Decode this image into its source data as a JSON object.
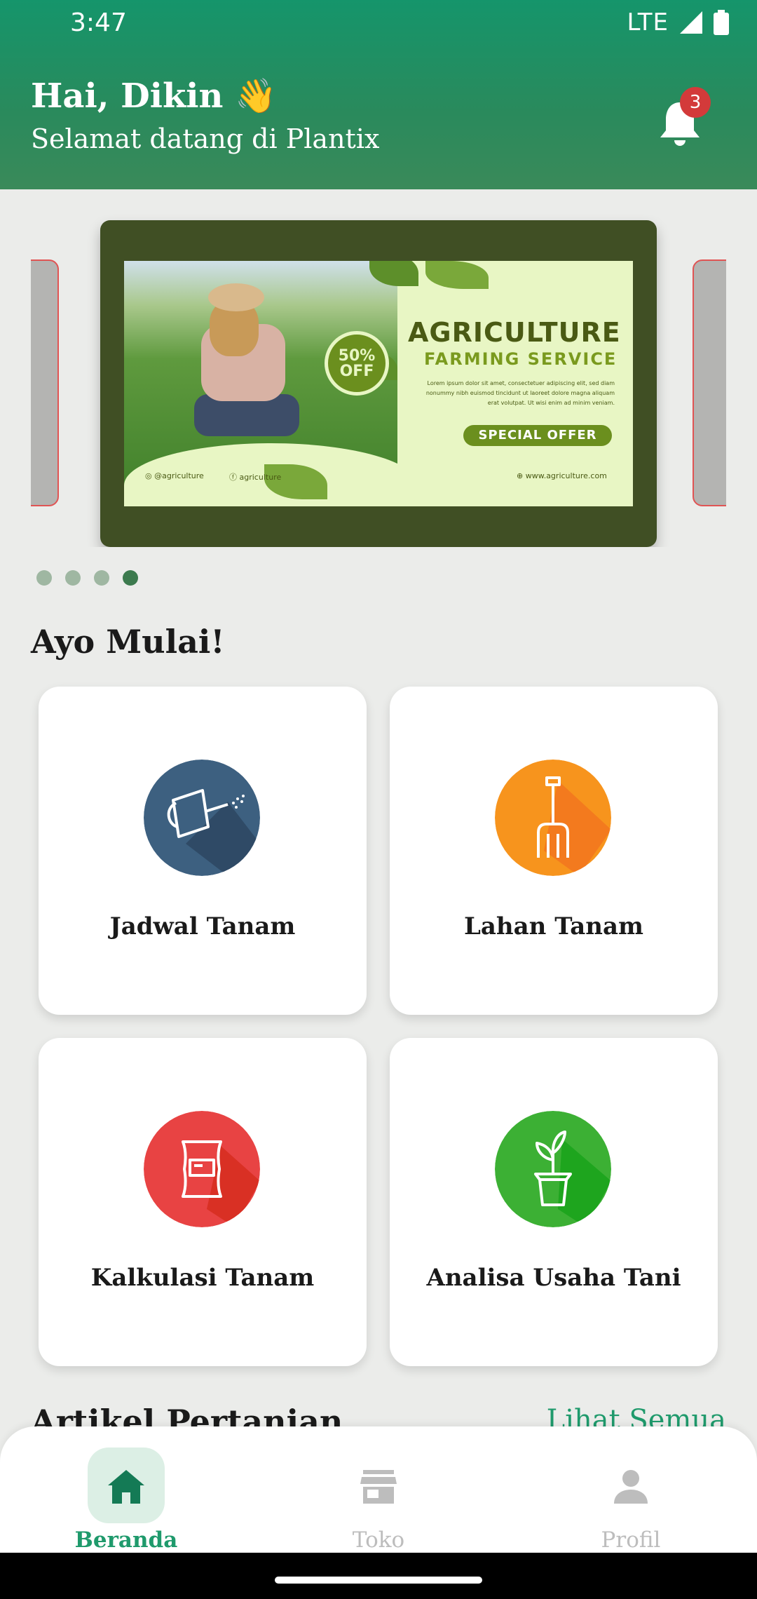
{
  "status_bar": {
    "time": "3:47",
    "network": "LTE"
  },
  "header": {
    "greeting": "Hai, Dikin 👋",
    "welcome": "Selamat datang di Plantix",
    "notification_count": "3"
  },
  "banner": {
    "title": "AGRICULTURE",
    "subtitle": "FARMING SERVICE",
    "offer_pct": "50%",
    "offer_word": "OFF",
    "lorem": "Lorem ipsum dolor sit amet, consectetuer adipiscing elit, sed diam nonummy nibh euismod tincidunt ut laoreet dolore magna aliquam erat volutpat. Ut wisi enim ad minim veniam.",
    "special": "SPECIAL OFFER",
    "instagram": "@agriculture",
    "facebook": "agriculture",
    "website": "www.agriculture.com",
    "page_count": 4,
    "active_page": 4
  },
  "section_title": "Ayo Mulai!",
  "menu": [
    {
      "label": "Jadwal Tanam",
      "icon": "watering-can-icon",
      "color": "#3d6080"
    },
    {
      "label": "Lahan Tanam",
      "icon": "pitchfork-icon",
      "color": "#f7941d"
    },
    {
      "label": "Kalkulasi Tanam",
      "icon": "fertilizer-sack-icon",
      "color": "#e84343"
    },
    {
      "label": "Analisa Usaha Tani",
      "icon": "potted-plant-icon",
      "color": "#3cb034"
    }
  ],
  "articles": {
    "title": "Artikel Pertanian",
    "see_all": "Lihat Semua"
  },
  "nav": [
    {
      "label": "Beranda",
      "icon": "home-icon",
      "active": true
    },
    {
      "label": "Toko",
      "icon": "store-icon",
      "active": false
    },
    {
      "label": "Profil",
      "icon": "person-icon",
      "active": false
    }
  ],
  "colors": {
    "primary": "#15956b",
    "accent_text": "#1f9a6c",
    "badge": "#d33a3a"
  }
}
